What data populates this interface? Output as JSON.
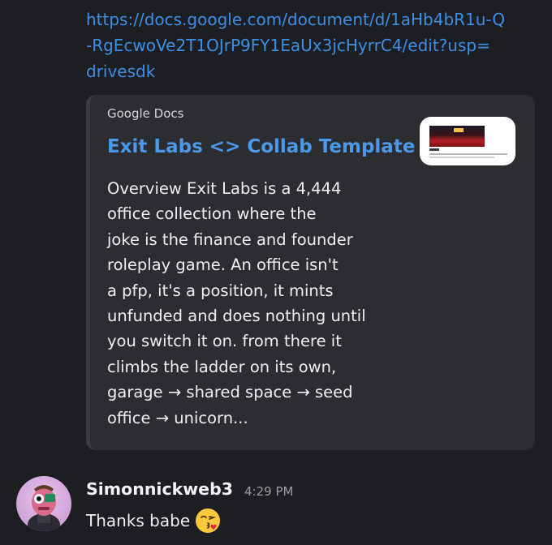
{
  "message_link": {
    "lines": [
      "https://docs.google.com/document/d/1aHb4bR1u-Q",
      "-RgEcwoVe2T1OJrP9FY1EaUx3jcHyrrC4/edit?usp=",
      "drivesdk"
    ]
  },
  "embed": {
    "provider": "Google Docs",
    "title": "Exit Labs <> Collab Template",
    "description_lines": [
      "Overview   Exit Labs is a 4,444",
      "office collection where the",
      "joke is the finance and founder",
      "roleplay game. An office isn't",
      "a pfp, it's a position, it mints",
      "unfunded and does nothing until",
      "you switch it on. from there it",
      "climbs the ladder on its own,",
      "garage → shared space → seed",
      "office → unicorn..."
    ],
    "accent_color": "#3a3c41",
    "title_color": "#4a99ea"
  },
  "message": {
    "username": "Simonnickweb3",
    "timestamp": "4:29 PM",
    "text": "Thanks babe",
    "emoji": "face-blowing-a-kiss"
  },
  "colors": {
    "background": "#1d1e22",
    "link": "#3d8fe6",
    "embed_bg": "#2b2d31"
  }
}
